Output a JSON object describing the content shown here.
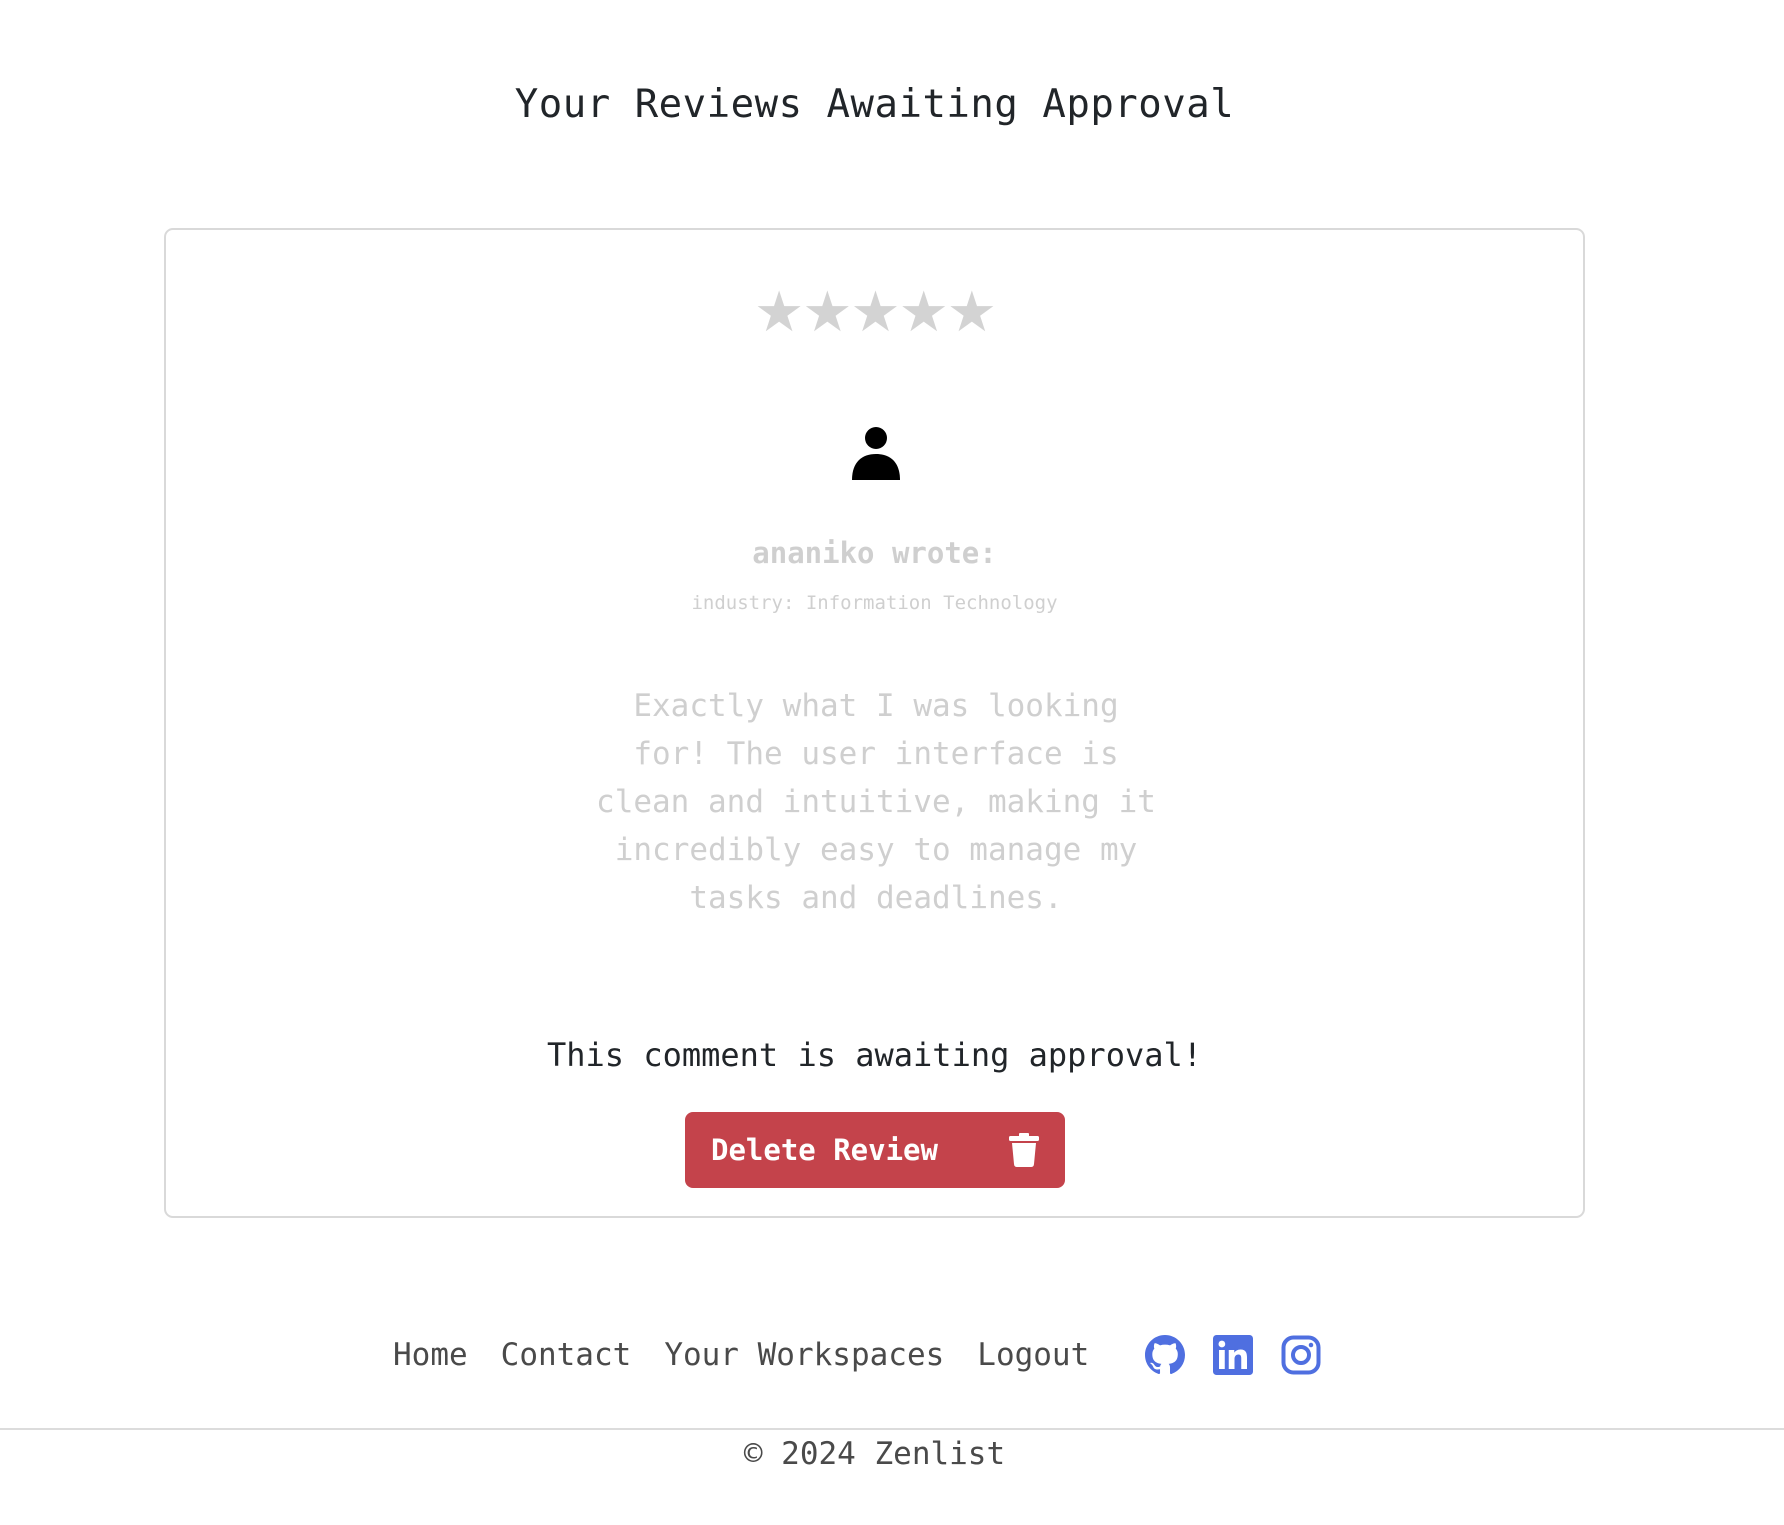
{
  "page": {
    "title": "Your Reviews Awaiting Approval"
  },
  "review": {
    "rating": 0,
    "max_rating": 5,
    "stars": [
      "★",
      "★",
      "★",
      "★",
      "★"
    ],
    "star_color": "#d3d3d3",
    "author_line": "ananiko wrote:",
    "industry_line": "industry: Information Technology",
    "text": "Exactly what I was looking for! The user interface is clean and intuitive, making it incredibly easy to manage my tasks and deadlines.",
    "status_message": "This comment is awaiting approval!",
    "delete_label": "Delete Review",
    "delete_color": "#c4434b",
    "author_icon": "user-icon",
    "delete_icon": "trash-icon"
  },
  "footer": {
    "links": [
      "Home",
      "Contact",
      "Your Workspaces",
      "Logout"
    ],
    "social": [
      "github-icon",
      "linkedin-icon",
      "instagram-icon"
    ],
    "social_color": "#4f6fe0",
    "copyright": "© 2024 Zenlist"
  }
}
